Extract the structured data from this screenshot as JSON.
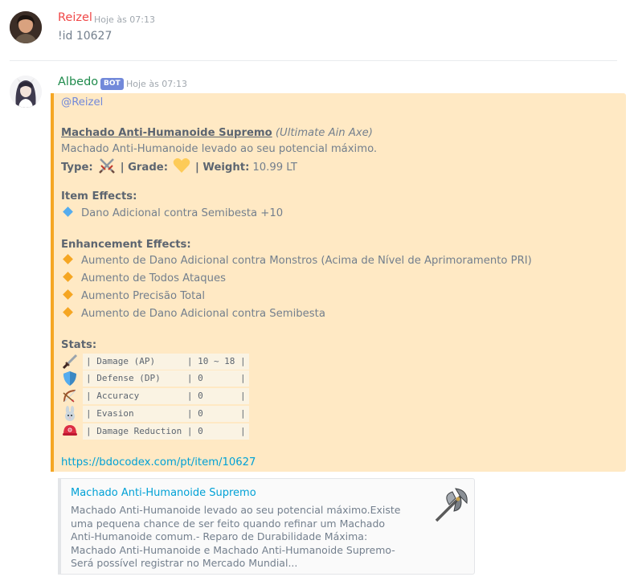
{
  "messages": [
    {
      "username": "Reizel",
      "username_color": "#f04747",
      "timestamp": "Hoje às 07:13",
      "text": "!id 10627"
    },
    {
      "username": "Albedo",
      "username_color": "#1f8b4c",
      "bot_tag": "BOT",
      "timestamp": "Hoje às 07:13"
    }
  ],
  "embed": {
    "accent_color": "#f5a623",
    "mention": "@Reizel",
    "title": "Machado Anti-Humanoide Supremo",
    "title_sub": "(Ultimate Ain Axe)",
    "description": "Machado Anti-Humanoide levado ao seu potencial máximo.",
    "type_label": "Type:",
    "type_icon": "crossed-swords-icon",
    "grade_label": "| Grade:",
    "grade_icon": "yellow-heart-icon",
    "weight_label": "| Weight:",
    "weight_value": "10.99 LT",
    "item_effects_title": "Item Effects:",
    "item_effects": [
      "Dano Adicional contra Semibesta +10"
    ],
    "enhancement_title": "Enhancement Effects:",
    "enhancement_effects": [
      "Aumento de Dano Adicional contra Monstros (Acima de Nível de Aprimoramento PRI)",
      "Aumento de Todos Ataques",
      "Aumento Precisão Total",
      "Aumento de Dano Adicional contra Semibesta"
    ],
    "stats_title": "Stats:",
    "stats": [
      {
        "icon": "dagger-icon",
        "text": "| Damage (AP)      | 10 ~ 18 |"
      },
      {
        "icon": "shield-icon",
        "text": "| Defense (DP)     | 0       |"
      },
      {
        "icon": "bow-arrow-icon",
        "text": "| Accuracy         | 0       |"
      },
      {
        "icon": "rabbit-icon",
        "text": "| Evasion          | 0       |"
      },
      {
        "icon": "helmet-icon",
        "text": "| Damage Reduction | 0       |"
      }
    ],
    "link": "https://bdocodex.com/pt/item/10627"
  },
  "preview": {
    "title": "Machado Anti-Humanoide Supremo",
    "description": "Machado Anti-Humanoide levado ao seu potencial máximo.Existe uma pequena chance de ser feito quando refinar um Machado Anti-Humanoide comum.- Reparo de Durabilidade Máxima: Machado Anti-Humanoide e Machado Anti-Humanoide Supremo- Será possível registrar no Mercado Mundial...",
    "thumb_icon": "battle-axe-icon"
  }
}
